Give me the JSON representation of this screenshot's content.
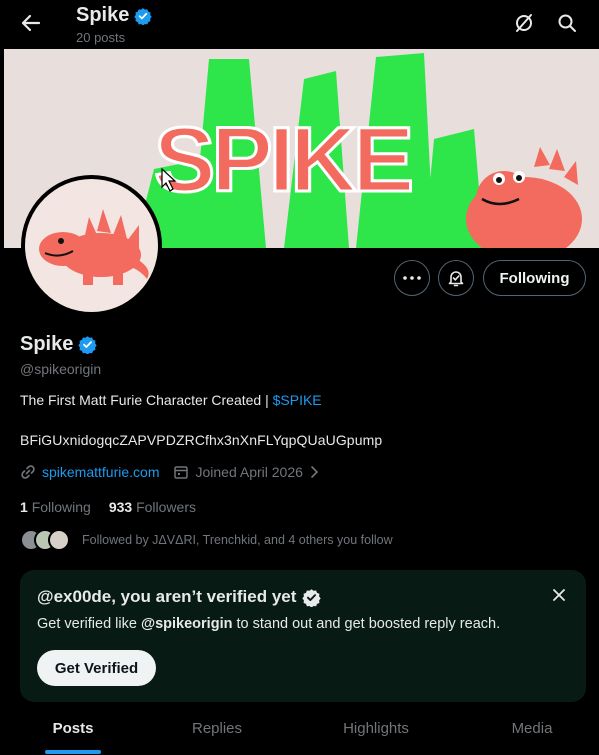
{
  "header": {
    "title": "Spike",
    "posts_count": "20 posts"
  },
  "profile": {
    "name": "Spike",
    "handle": "@spikeorigin",
    "bio_text": "The First Matt Furie Character Created | ",
    "bio_cashtag": "$SPIKE",
    "contract_address": "BFiGUxnidogqcZAPVPDZRCfhx3nXnFLYqpQUaUGpump",
    "website": "spikemattfurie.com",
    "joined": "Joined April 2026",
    "following_count": "1",
    "following_label": "Following",
    "followers_count": "933",
    "followers_label": "Followers",
    "followed_by": "Followed by JΔVΔRI, Trenchkid, and 4 others you follow",
    "banner_text": "SPIKE"
  },
  "actions": {
    "following_button": "Following"
  },
  "verify_card": {
    "title": "@ex00de, you aren’t verified yet",
    "text_prefix": "Get verified like ",
    "text_handle": "@spikeorigin",
    "text_suffix": " to stand out and get boosted reply reach.",
    "button": "Get Verified"
  },
  "tabs": [
    "Posts",
    "Replies",
    "Highlights",
    "Media"
  ],
  "colors": {
    "accent": "#1d9bf0",
    "banner_green": "#2ee64a",
    "spike_pink": "#f26b5e"
  }
}
